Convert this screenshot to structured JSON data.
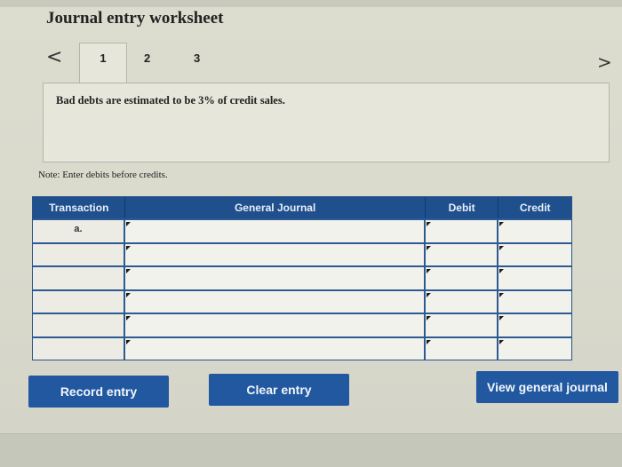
{
  "worksheet": {
    "title": "Journal entry worksheet",
    "tabs": [
      {
        "label": "1",
        "active": true
      },
      {
        "label": "2",
        "active": false
      },
      {
        "label": "3",
        "active": false
      }
    ],
    "prev_arrow": "<",
    "next_arrow": ">",
    "prompt": "Bad debts are estimated to be 3% of credit sales.",
    "note": "Note: Enter debits before credits."
  },
  "journal_table": {
    "headers": [
      "Transaction",
      "General Journal",
      "Debit",
      "Credit"
    ],
    "rows": [
      {
        "transaction": "a.",
        "account": "",
        "debit": "",
        "credit": ""
      },
      {
        "transaction": "",
        "account": "",
        "debit": "",
        "credit": ""
      },
      {
        "transaction": "",
        "account": "",
        "debit": "",
        "credit": ""
      },
      {
        "transaction": "",
        "account": "",
        "debit": "",
        "credit": ""
      },
      {
        "transaction": "",
        "account": "",
        "debit": "",
        "credit": ""
      },
      {
        "transaction": "",
        "account": "",
        "debit": "",
        "credit": ""
      }
    ]
  },
  "buttons": {
    "record": "Record entry",
    "clear": "Clear entry",
    "view": "View general journal"
  },
  "colors": {
    "header_bg": "#1f4f8d",
    "button_bg": "#2158a0"
  }
}
